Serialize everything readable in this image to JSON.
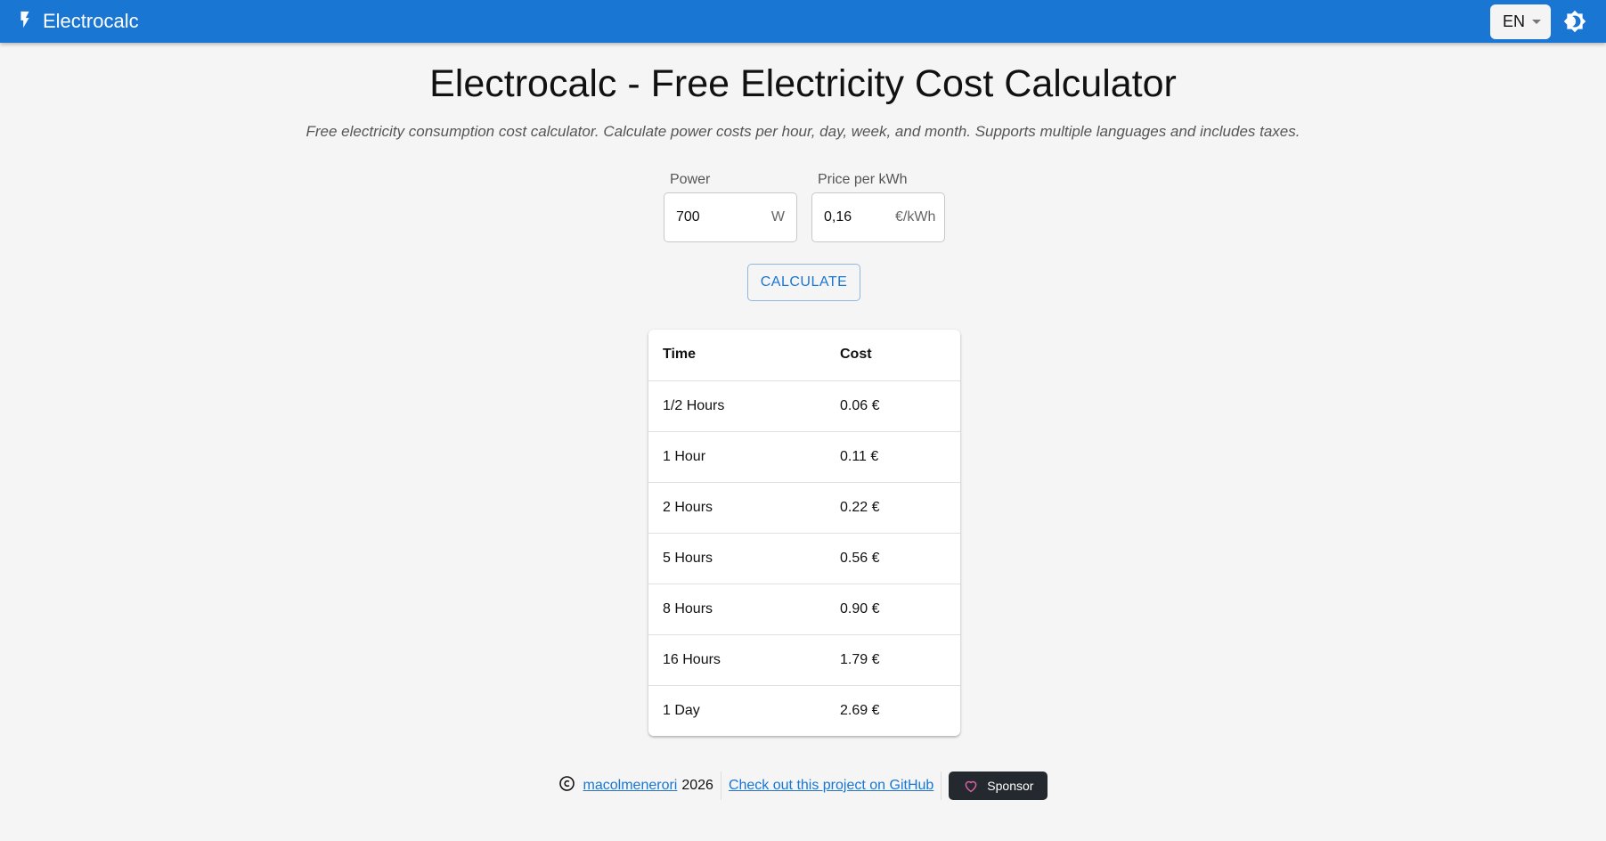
{
  "header": {
    "app_name": "Electrocalc",
    "language": "EN",
    "icons": {
      "brand": "bolt-icon",
      "theme": "brightness-icon"
    },
    "accent_color": "#1976d2"
  },
  "main": {
    "title": "Electrocalc - Free Electricity Cost Calculator",
    "subtitle": "Free electricity consumption cost calculator. Calculate power costs per hour, day, week, and month. Supports multiple languages and includes taxes.",
    "power": {
      "label": "Power",
      "value": "700",
      "unit": "W"
    },
    "price": {
      "label": "Price per kWh",
      "value": "0,16",
      "unit": "€/kWh"
    },
    "calculate_label": "CALCULATE"
  },
  "results": {
    "headers": [
      "Time",
      "Cost"
    ],
    "rows": [
      [
        "1/2 Hours",
        "0.06 €"
      ],
      [
        "1 Hour",
        "0.11 €"
      ],
      [
        "2 Hours",
        "0.22 €"
      ],
      [
        "5 Hours",
        "0.56 €"
      ],
      [
        "8 Hours",
        "0.90 €"
      ],
      [
        "16 Hours",
        "1.79 €"
      ],
      [
        "1 Day",
        "2.69 €"
      ]
    ]
  },
  "footer": {
    "author": "macolmenerori",
    "year": "2026",
    "github_label": "Check out this project on GitHub",
    "sponsor_label": "Sponsor",
    "icons": {
      "copyright": "copyright-icon",
      "sponsor": "heart-icon"
    }
  }
}
